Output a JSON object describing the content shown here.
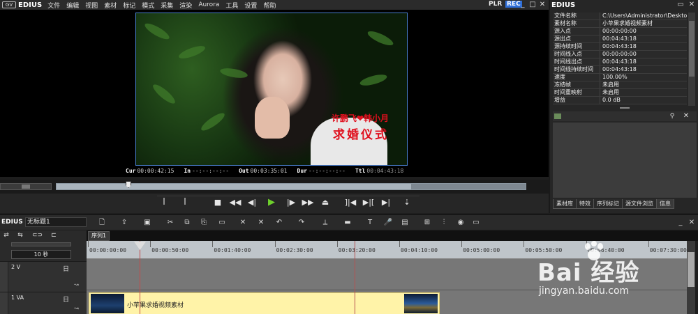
{
  "app": {
    "logo_text": "GV",
    "name": "EDIUS",
    "menu": [
      "文件",
      "编辑",
      "视图",
      "素材",
      "标记",
      "模式",
      "采集",
      "渲染",
      "Aurora",
      "工具",
      "设置",
      "帮助"
    ],
    "plr_label": "PLR",
    "rec_label": "REC",
    "window_buttons": [
      "_",
      "□",
      "✕"
    ]
  },
  "preview": {
    "overlay_line1": "许鹏飞❤韩小月",
    "overlay_line2": "求婚仪式",
    "timecodes": [
      {
        "label": "Cur",
        "value": "00:00:42:15",
        "dim": false
      },
      {
        "label": "In",
        "value": "--:--:--:--",
        "dim": false
      },
      {
        "label": "Out",
        "value": "00:03:35:01",
        "dim": false
      },
      {
        "label": "Dur",
        "value": "--:--:--:--",
        "dim": false
      },
      {
        "label": "Ttl",
        "value": "00:04:43:18",
        "dim": true
      }
    ]
  },
  "transport": {
    "buttons": [
      "ꟾ",
      "ꟾ",
      "■",
      "◀◀",
      "◀|",
      "▶",
      "|▶",
      "▶▶",
      "⏏",
      "]|◀",
      "▶|[",
      "▶|",
      "⇣"
    ]
  },
  "info_panel": {
    "title": "EDIUS",
    "rows": [
      {
        "key": "文件名称",
        "value": "C:\\Users\\Administrator\\Deskto..."
      },
      {
        "key": "素材名称",
        "value": "小苹果求婚视频素材"
      },
      {
        "key": "源入点",
        "value": "00:00:00:00"
      },
      {
        "key": "源出点",
        "value": "00:04:43:18"
      },
      {
        "key": "源持续时间",
        "value": "00:04:43:18"
      },
      {
        "key": "时间线入点",
        "value": "00:00:00:00"
      },
      {
        "key": "时间线出点",
        "value": "00:04:43:18"
      },
      {
        "key": "时间线持续时间",
        "value": "00:04:43:18"
      },
      {
        "key": "速度",
        "value": "100.00%"
      },
      {
        "key": "冻结帧",
        "value": "未启用"
      },
      {
        "key": "时间重映射",
        "value": "未启用"
      },
      {
        "key": "增益",
        "value": "0.0 dB"
      }
    ],
    "tabs": [
      "素材库",
      "特效",
      "序列标记",
      "源文件浏览",
      "信息"
    ]
  },
  "timeline": {
    "brand": "EDIUS",
    "project_name": "无标题1",
    "zoom_label": "10 秒",
    "sequence_tab": "序列1",
    "ruler": [
      "00:00:00:00",
      "00:00:50:00",
      "00:01:40:00",
      "00:02:30:00",
      "00:03:20:00",
      "00:04:10:00",
      "00:05:00:00",
      "00:05:50:00",
      "00:06:40:00",
      "00:07:30:00"
    ],
    "tracks": [
      {
        "label": "2 V",
        "lock": "日"
      },
      {
        "label": "1 VA",
        "lock": "日"
      }
    ],
    "clip_name": "小苹果求婚视频素材"
  },
  "watermark": {
    "text": "Bai 经验",
    "url": "jingyan.baidu.com"
  },
  "colors": {
    "accent_rec": "#2f6fd8",
    "play_green": "#6ed02c",
    "clip_yellow": "#fff3a8",
    "overlay_red": "#e0101e"
  }
}
